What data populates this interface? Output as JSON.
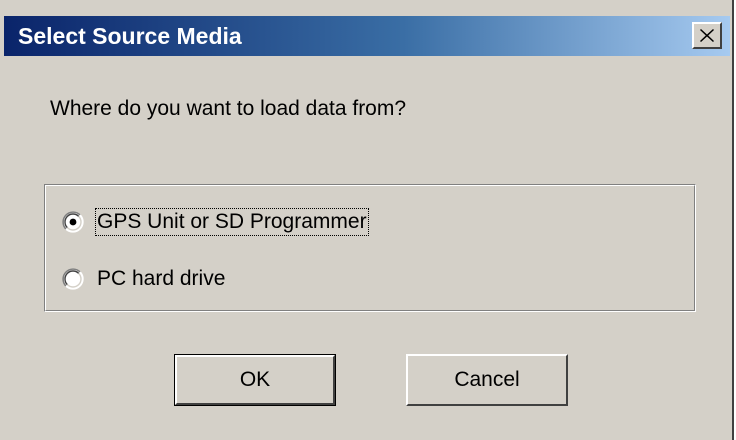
{
  "window": {
    "title": "Select Source Media",
    "close_icon": "close-icon"
  },
  "prompt": "Where do you want to load data from?",
  "source_options": [
    {
      "label": "GPS Unit or SD Programmer",
      "selected": true,
      "focused": true
    },
    {
      "label": "PC hard drive",
      "selected": false,
      "focused": false
    }
  ],
  "buttons": {
    "ok_label": "OK",
    "cancel_label": "Cancel"
  },
  "colors": {
    "dialog_face": "#d4d0c8",
    "titlebar_start": "#0a246a",
    "titlebar_end": "#a6caf0",
    "title_text": "#ffffff"
  }
}
